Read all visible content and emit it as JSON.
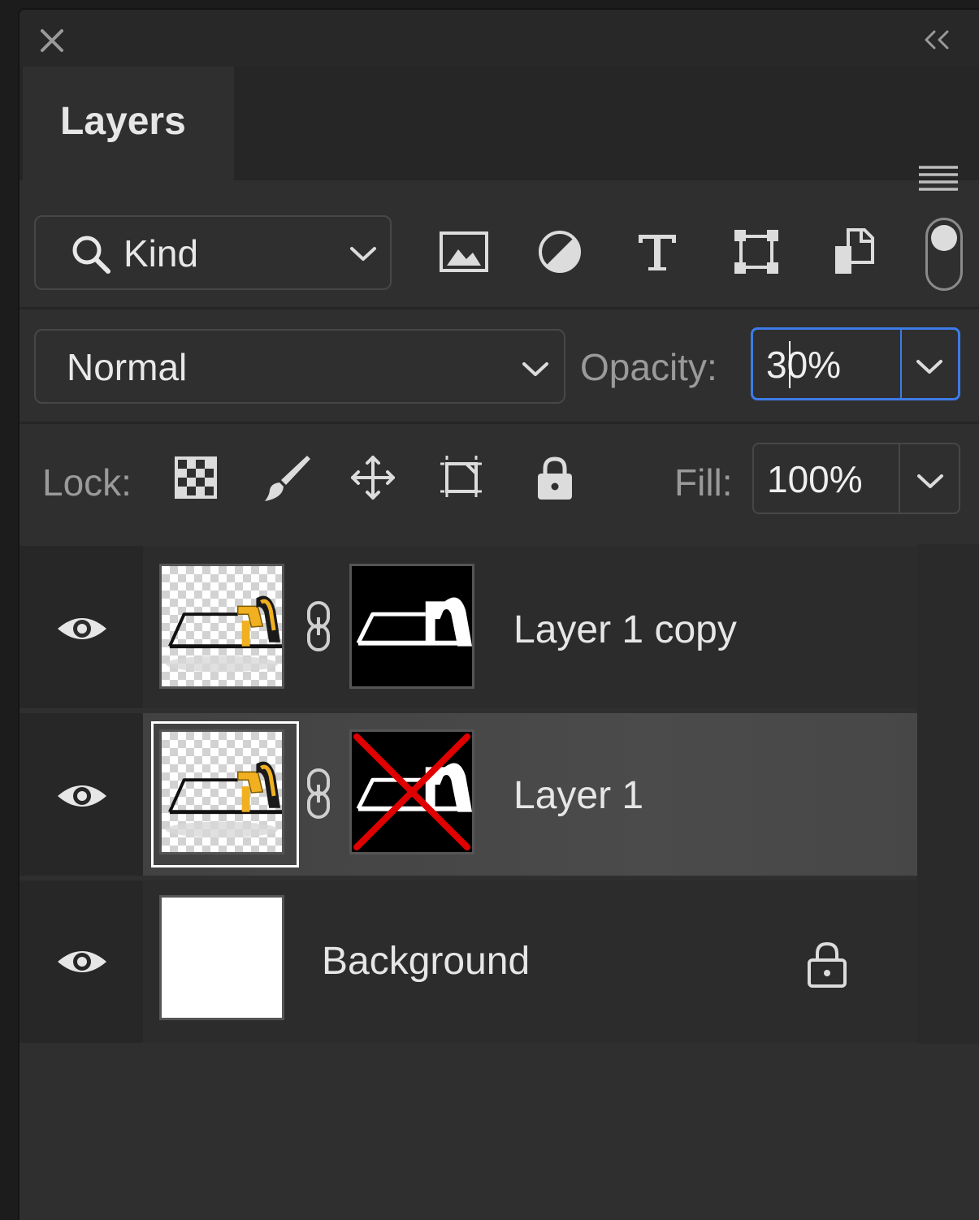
{
  "panel": {
    "title": "Layers",
    "close_icon": "close-icon",
    "collapse_icon": "double-chevron-left-icon",
    "menu_icon": "hamburger-menu-icon"
  },
  "filter": {
    "kind_label": "Kind",
    "icons": [
      "pixel-layer-filter-icon",
      "adjustment-layer-filter-icon",
      "type-layer-filter-icon",
      "shape-layer-filter-icon",
      "smart-object-filter-icon"
    ],
    "filter_toggle_on": true
  },
  "blend": {
    "mode": "Normal",
    "opacity_label": "Opacity:",
    "opacity_value": "30%",
    "opacity_field_focused": true
  },
  "lock": {
    "label": "Lock:",
    "icons": [
      "lock-transparent-pixels-icon",
      "lock-image-pixels-icon",
      "lock-position-icon",
      "lock-artboard-icon",
      "lock-all-icon"
    ],
    "fill_label": "Fill:",
    "fill_value": "100%"
  },
  "layers": [
    {
      "name": "Layer 1 copy",
      "visible": true,
      "selected": false,
      "mask": true,
      "mask_disabled": false
    },
    {
      "name": "Layer 1",
      "visible": true,
      "selected": true,
      "mask": true,
      "mask_disabled": true
    },
    {
      "name": "Background",
      "visible": true,
      "selected": false,
      "mask": false,
      "locked": true
    }
  ],
  "colors": {
    "panel_bg": "#2f2f2f",
    "focus_ring": "#3d7be6",
    "selected_row": "#454545",
    "mask_disabled_x": "#e00000",
    "saw_handle": "#f0b020"
  }
}
